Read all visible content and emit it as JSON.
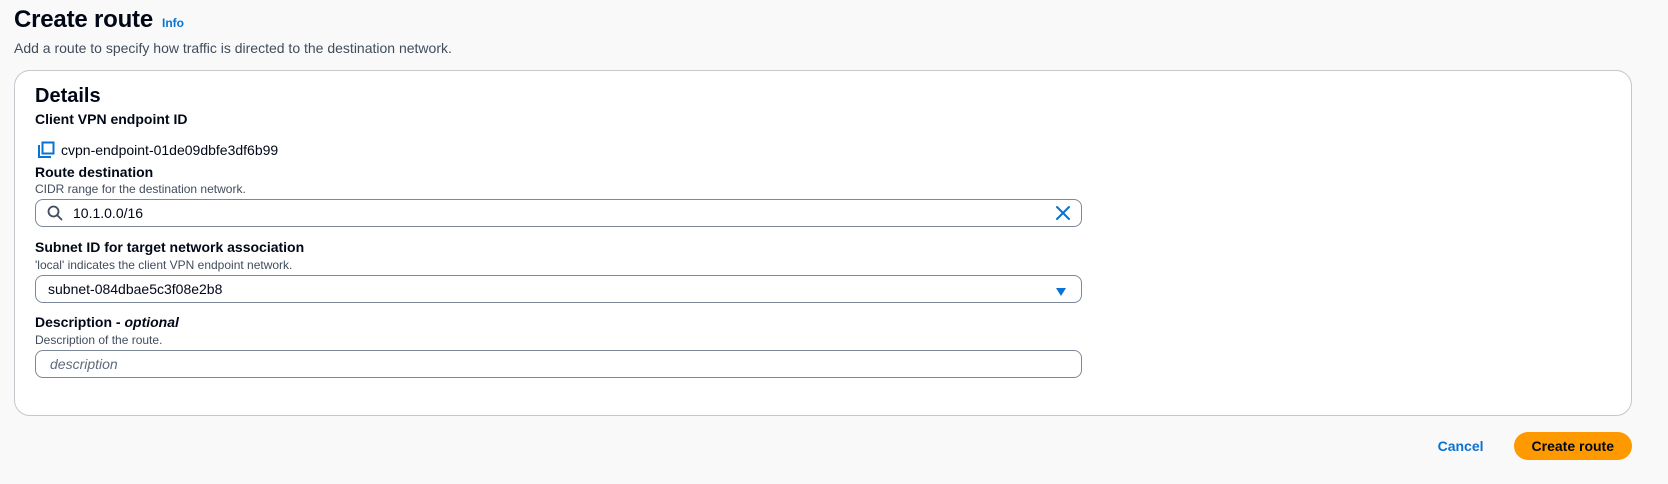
{
  "header": {
    "title": "Create route",
    "info_link": "Info",
    "description": "Add a route to specify how traffic is directed to the destination network."
  },
  "details": {
    "title": "Details",
    "endpoint": {
      "label": "Client VPN endpoint ID",
      "value": "cvpn-endpoint-01de09dbfe3df6b99",
      "icon": "copy-icon"
    },
    "route_destination": {
      "label": "Route destination",
      "hint": "CIDR range for the destination network.",
      "value": "10.1.0.0/16",
      "icons": [
        "search-icon",
        "clear-icon"
      ]
    },
    "subnet": {
      "label": "Subnet ID for target network association",
      "hint": "'local' indicates the client VPN endpoint network.",
      "selected": "subnet-084dbae5c3f08e2b8",
      "icon": "caret-down-icon"
    },
    "description": {
      "label": "Description",
      "label_optional": "optional",
      "hint": "Description of the route.",
      "value": "",
      "placeholder": "description"
    }
  },
  "actions": {
    "cancel_label": "Cancel",
    "submit_label": "Create route"
  },
  "colors": {
    "accent": "#0972d3",
    "primary_button": "#ff9900",
    "panel_border": "#c6c6cd",
    "background": "#f9f9f9"
  }
}
